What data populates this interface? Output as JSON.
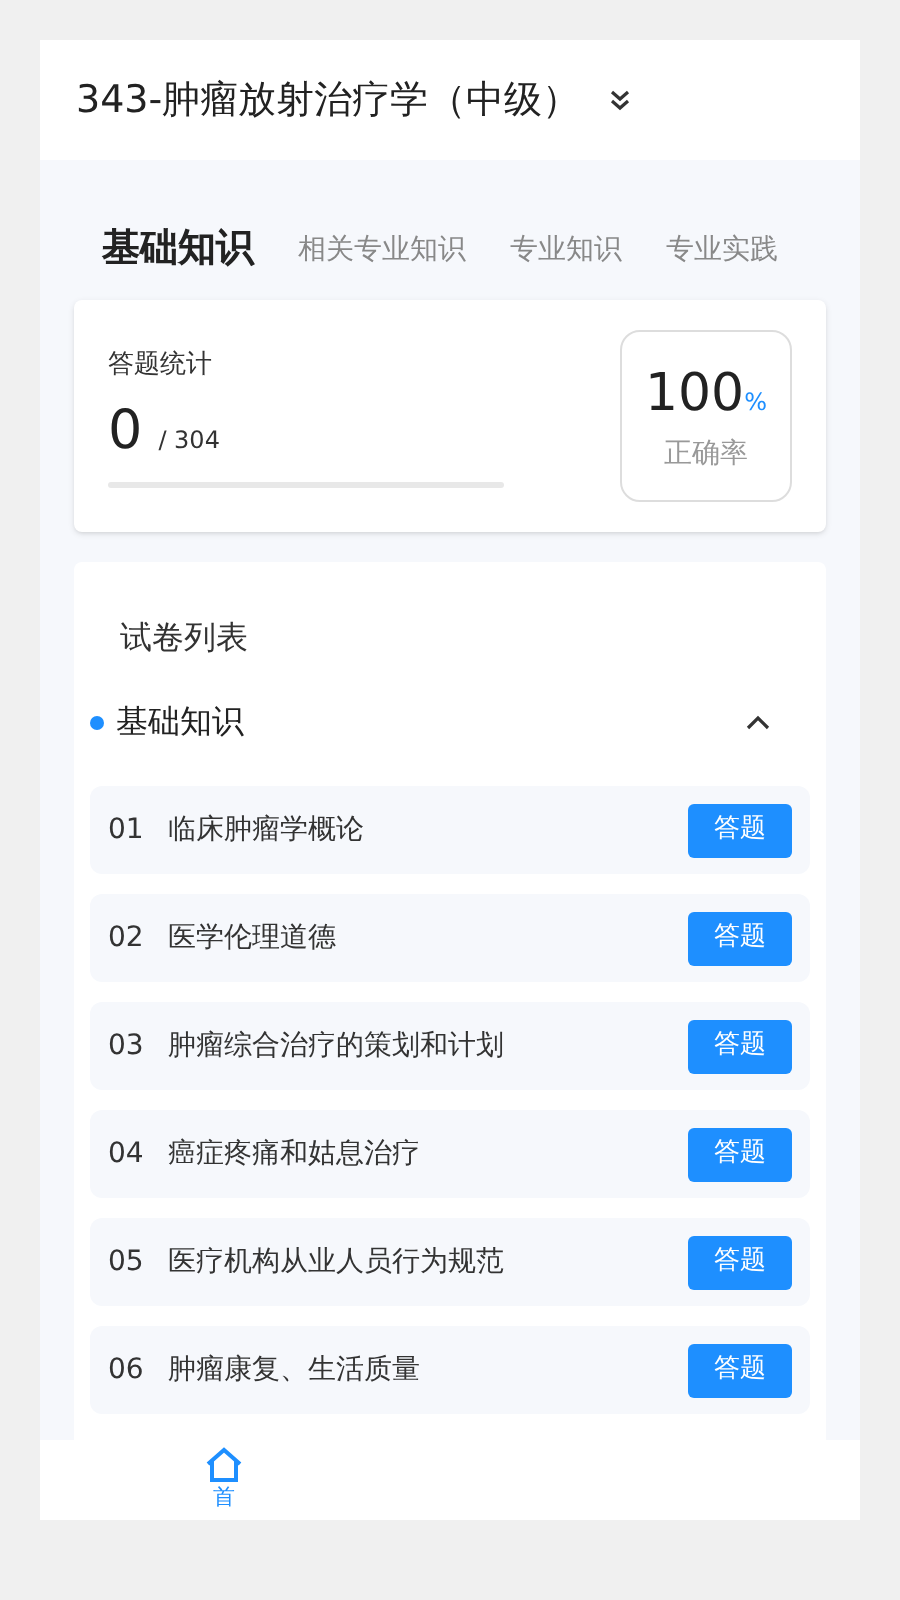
{
  "header": {
    "title": "343-肿瘤放射治疗学（中级）"
  },
  "tabs": [
    {
      "label": "基础知识",
      "selected": true
    },
    {
      "label": "相关专业知识",
      "selected": false
    },
    {
      "label": "专业知识",
      "selected": false
    },
    {
      "label": "专业实践",
      "selected": false
    }
  ],
  "stats": {
    "title": "答题统计",
    "answered": "0",
    "total": "/ 304",
    "level": 0,
    "rate": "100",
    "rate_unit": "%",
    "rate_label": "正确率"
  },
  "paper_list": {
    "title": "试卷列表",
    "section": {
      "title": "基础知识",
      "expanded": true
    },
    "items": [
      {
        "number": "01",
        "name": "临床肿瘤学概论",
        "action": "答题"
      },
      {
        "number": "02",
        "name": "医学伦理道德",
        "action": "答题"
      },
      {
        "number": "03",
        "name": "肿瘤综合治疗的策划和计划",
        "action": "答题"
      },
      {
        "number": "04",
        "name": "癌症疼痛和姑息治疗",
        "action": "答题"
      },
      {
        "number": "05",
        "name": "医疗机构从业人员行为规范",
        "action": "答题"
      },
      {
        "number": "06",
        "name": "肿瘤康复、生活质量",
        "action": "答题"
      }
    ]
  },
  "bottom_nav": [
    {
      "label": "首",
      "selected": true
    }
  ]
}
